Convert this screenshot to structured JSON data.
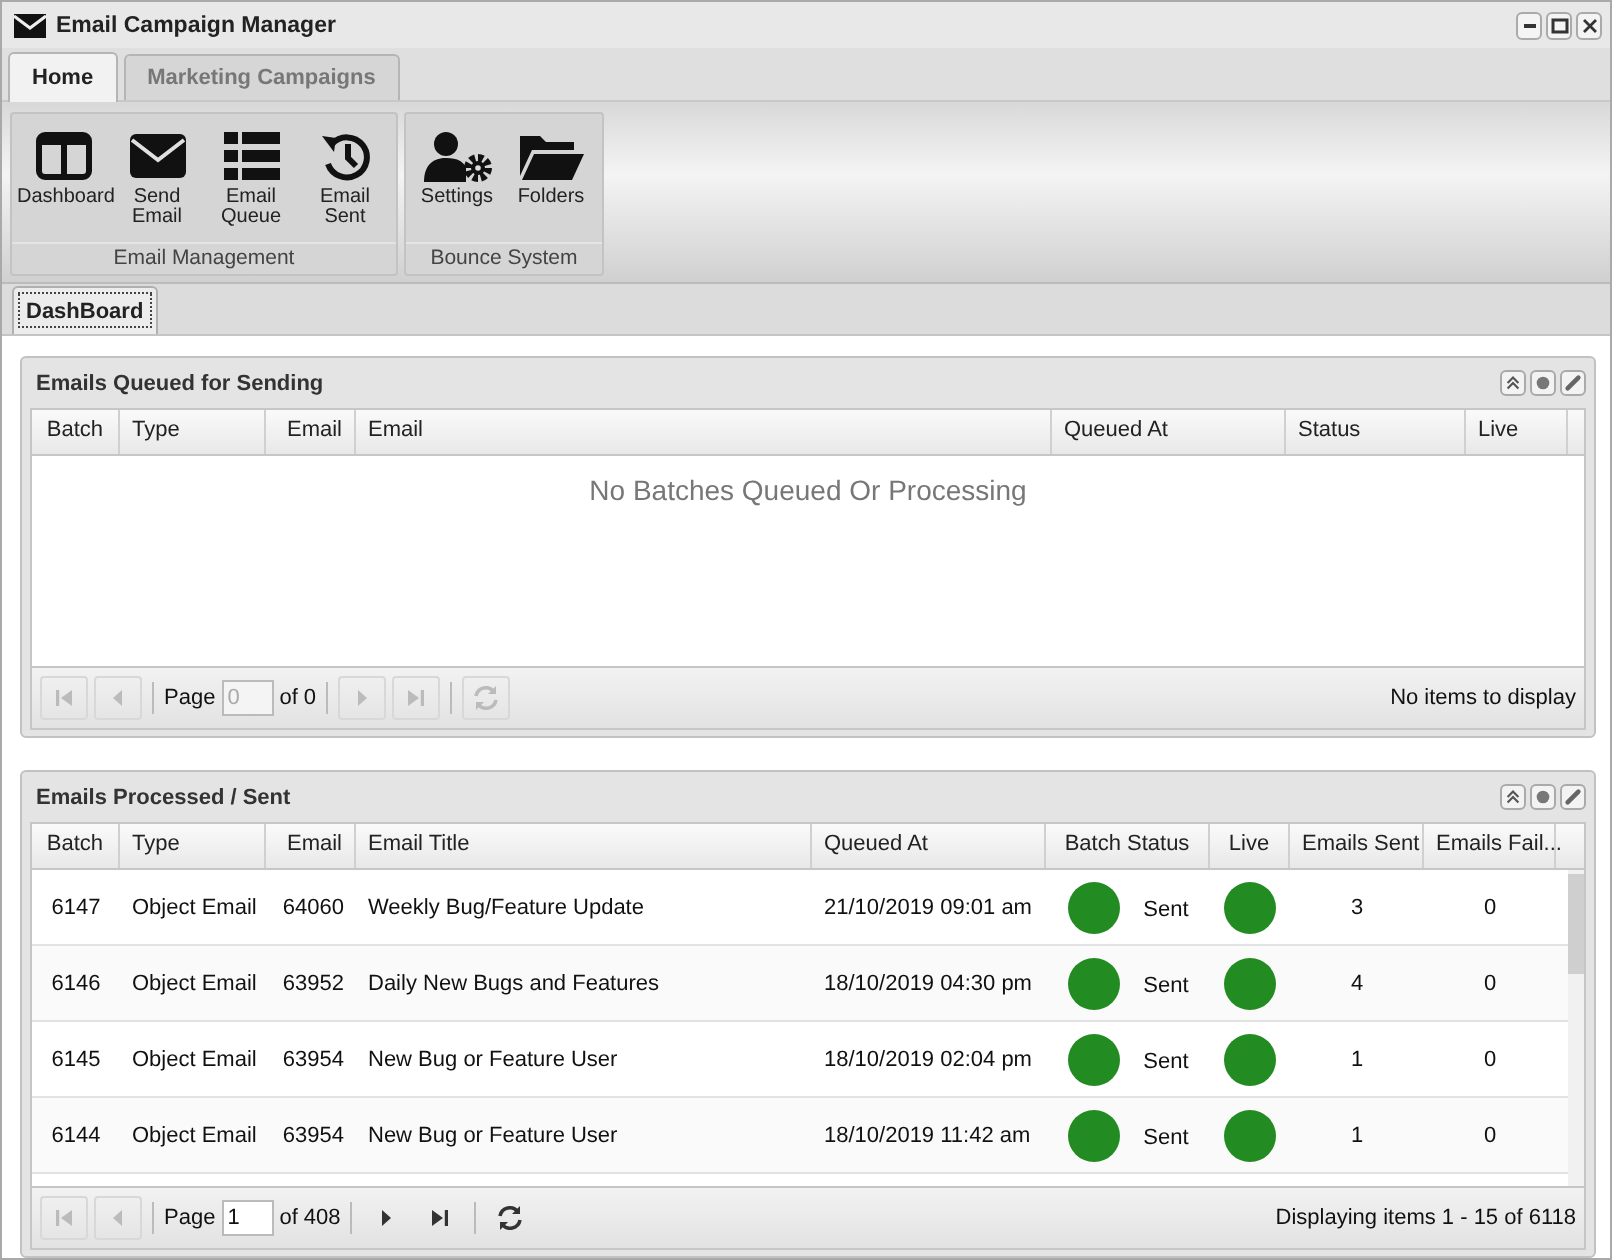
{
  "window": {
    "title": "Email Campaign Manager"
  },
  "tabs": [
    {
      "label": "Home",
      "selected": true
    },
    {
      "label": "Marketing Campaigns",
      "selected": false
    }
  ],
  "ribbon_groups": [
    {
      "label": "Email Management",
      "items": [
        {
          "label": "Dashboard",
          "kind": "dashboard"
        },
        {
          "label": "Send Email",
          "kind": "envelope"
        },
        {
          "label": "Email Queue",
          "kind": "list"
        },
        {
          "label": "Email Sent",
          "kind": "history"
        }
      ]
    },
    {
      "label": "Bounce System",
      "items": [
        {
          "label": "Settings",
          "kind": "user-gear"
        },
        {
          "label": "Folders",
          "kind": "folder"
        }
      ]
    }
  ],
  "doc_tabs": [
    {
      "label": "DashBoard",
      "selected": true
    }
  ],
  "panels": [
    {
      "title": "Emails Queued for Sending",
      "columns": [
        "Batch",
        "Type",
        "Email",
        "Email",
        "Queued At",
        "Status",
        "Live"
      ],
      "empty_text": "No Batches Queued Or Processing",
      "pager": {
        "page_label": "Page",
        "page": "0",
        "of": "of 0",
        "info": "No items to display",
        "buttons": [
          {
            "kind": "first",
            "disabled": true
          },
          {
            "kind": "prev",
            "disabled": true
          },
          {
            "kind": "next",
            "disabled": true
          },
          {
            "kind": "last",
            "disabled": true
          }
        ],
        "refresh_disabled": true
      }
    },
    {
      "title": "Emails Processed / Sent",
      "columns": [
        "Batch",
        "Type",
        "Email",
        "Email Title",
        "Queued At",
        "Batch Status",
        "Live",
        "Emails Sent",
        "Emails Fail..."
      ],
      "rows": [
        {
          "batch": "6147",
          "type": "Object Email",
          "email": "64060",
          "title": "Weekly Bug/Feature Update",
          "queued_at": "21/10/2019 09:01 am",
          "status_ok": true,
          "status": "Sent",
          "live": true,
          "sent": "3",
          "failed": "0"
        },
        {
          "batch": "6146",
          "type": "Object Email",
          "email": "63952",
          "title": "Daily New Bugs and Features",
          "queued_at": "18/10/2019 04:30 pm",
          "status_ok": true,
          "status": "Sent",
          "live": true,
          "sent": "4",
          "failed": "0"
        },
        {
          "batch": "6145",
          "type": "Object Email",
          "email": "63954",
          "title": "New Bug or Feature User",
          "queued_at": "18/10/2019 02:04 pm",
          "status_ok": true,
          "status": "Sent",
          "live": true,
          "sent": "1",
          "failed": "0"
        },
        {
          "batch": "6144",
          "type": "Object Email",
          "email": "63954",
          "title": "New Bug or Feature User",
          "queued_at": "18/10/2019 11:42 am",
          "status_ok": true,
          "status": "Sent",
          "live": true,
          "sent": "1",
          "failed": "0"
        }
      ],
      "pager": {
        "page_label": "Page",
        "page": "1",
        "of": "of 408",
        "info": "Displaying items 1 - 15 of 6118",
        "buttons": [
          {
            "kind": "first",
            "disabled": true
          },
          {
            "kind": "prev",
            "disabled": true
          },
          {
            "kind": "next",
            "disabled": false
          },
          {
            "kind": "last",
            "disabled": false
          }
        ],
        "refresh_disabled": false
      }
    }
  ]
}
